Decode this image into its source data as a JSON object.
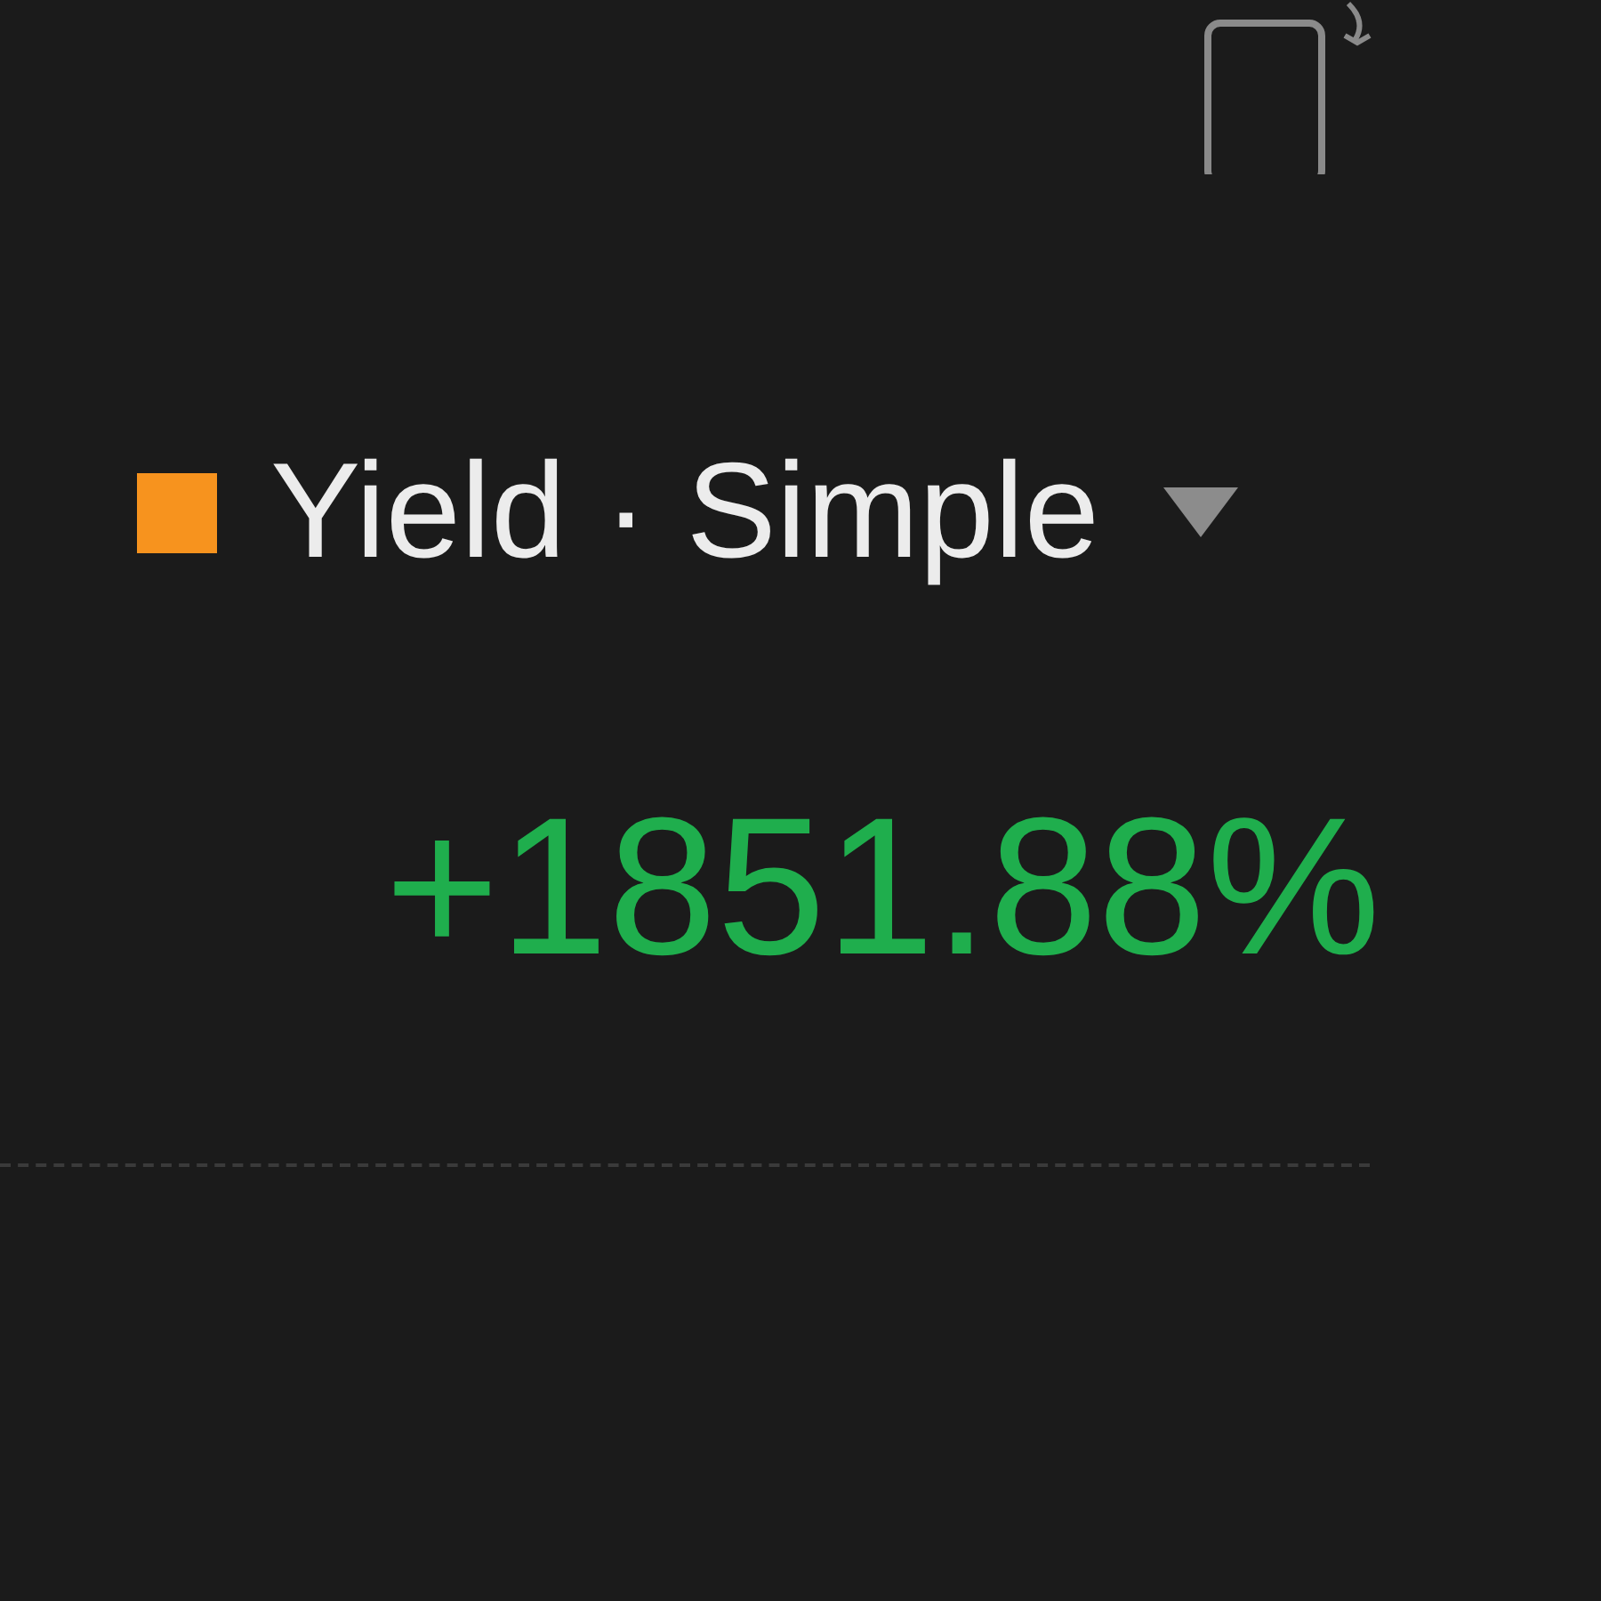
{
  "legend": {
    "color": "#f7931e",
    "label": "Yield · Simple"
  },
  "value": "+1851.88%"
}
